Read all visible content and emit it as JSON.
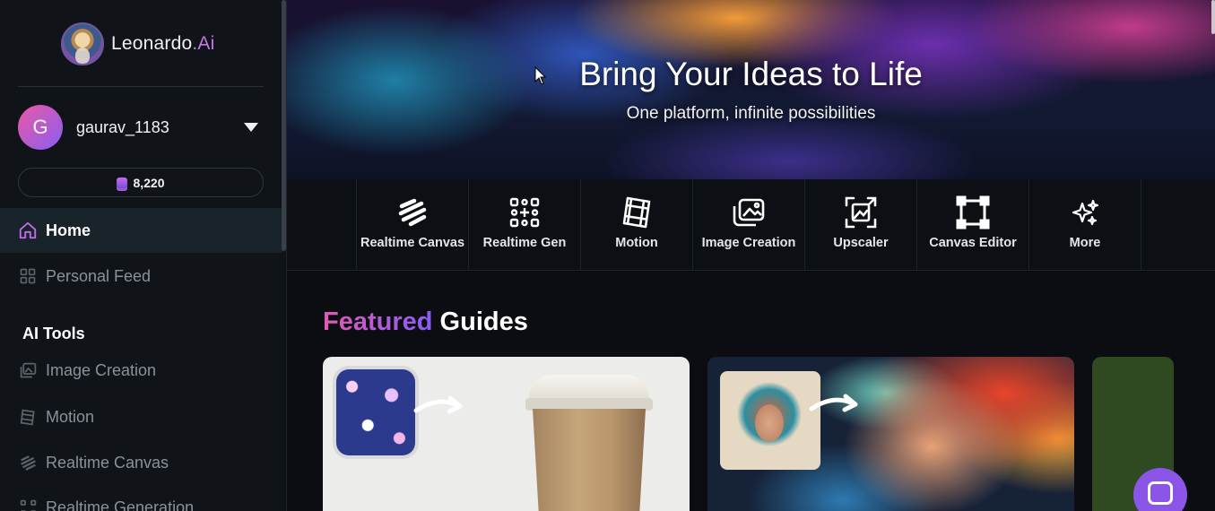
{
  "brand": {
    "name": "Leonardo",
    "suffix": ".Ai"
  },
  "user": {
    "initial": "G",
    "name": "gaurav_1183",
    "tokens": "8,220"
  },
  "nav": {
    "home": "Home",
    "personal_feed": "Personal Feed",
    "section_ai_tools": "AI Tools",
    "image_creation": "Image Creation",
    "motion": "Motion",
    "realtime_canvas": "Realtime Canvas",
    "realtime_generation": "Realtime Generation"
  },
  "hero": {
    "title": "Bring Your Ideas to Life",
    "subtitle": "One platform, infinite possibilities"
  },
  "tools": [
    {
      "label": "Realtime Canvas",
      "icon": "scribble-icon"
    },
    {
      "label": "Realtime Gen",
      "icon": "dots-grid-icon"
    },
    {
      "label": "Motion",
      "icon": "film-icon"
    },
    {
      "label": "Image Creation",
      "icon": "images-icon"
    },
    {
      "label": "Upscaler",
      "icon": "upscale-icon"
    },
    {
      "label": "Canvas Editor",
      "icon": "canvas-frame-icon"
    },
    {
      "label": "More",
      "icon": "sparkles-icon"
    }
  ],
  "featured": {
    "highlight": "Featured",
    "rest": "Guides"
  },
  "colors": {
    "accent": "#c955c8",
    "accent2": "#8a5cf6",
    "sidebar_bg": "#101419",
    "active_bg": "#18232a"
  }
}
